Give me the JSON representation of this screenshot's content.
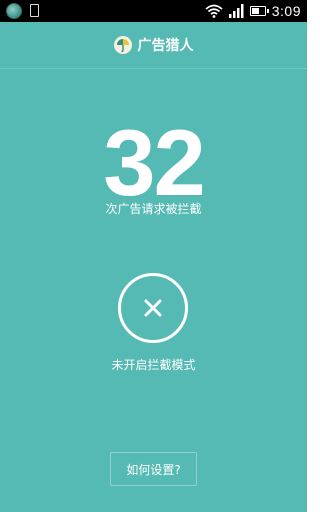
{
  "status_bar": {
    "time": "3:09",
    "battery_level": 0.7,
    "icons": [
      "app-notification-icon",
      "sd-card-icon",
      "wifi-icon",
      "signal-icon",
      "battery-icon"
    ]
  },
  "header": {
    "title": "广告猎人",
    "logo_icon": "umbrella-logo-icon"
  },
  "stats": {
    "blocked_count": "32",
    "blocked_caption": "次广告请求被拦截"
  },
  "mode": {
    "status_icon": "close-x-icon",
    "status_text": "未开启拦截模式"
  },
  "setup": {
    "button_label": "如何设置?"
  },
  "colors": {
    "background": "#56bab4",
    "status_bar": "#000000",
    "foreground": "#ffffff"
  }
}
